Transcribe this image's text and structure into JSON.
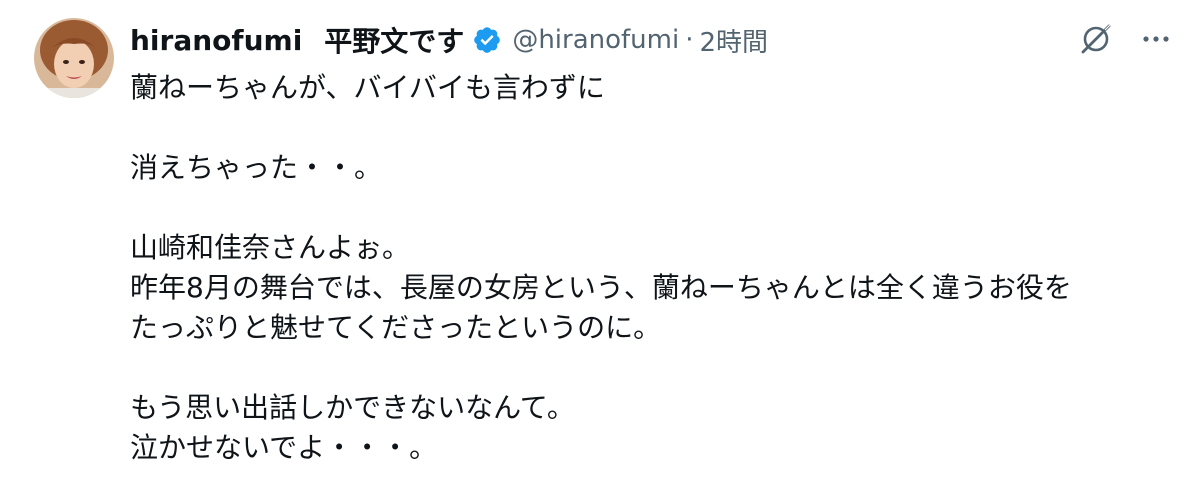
{
  "author": {
    "username": "hiranofumi",
    "name": "平野文です",
    "handle": "@hiranofumi",
    "separator": "·",
    "time": "2時間"
  },
  "icons": {
    "avatar": "profile-photo",
    "verified": "verified-badge-icon",
    "grok": "grok-icon",
    "more": "more-options-icon"
  },
  "colors": {
    "verified_blue": "#1d9bf0",
    "secondary_text": "#536471",
    "primary_text": "#0f1419"
  },
  "tweet": {
    "lines": [
      "蘭ねーちゃんが、バイバイも言わずに",
      "",
      "消えちゃった・・。",
      "",
      "山崎和佳奈さんよぉ。",
      "昨年8月の舞台では、長屋の女房という、蘭ねーちゃんとは全く違うお役を",
      "たっぷりと魅せてくださったというのに。",
      "",
      "もう思い出話しかできないなんて。",
      "泣かせないでよ・・・。"
    ]
  }
}
